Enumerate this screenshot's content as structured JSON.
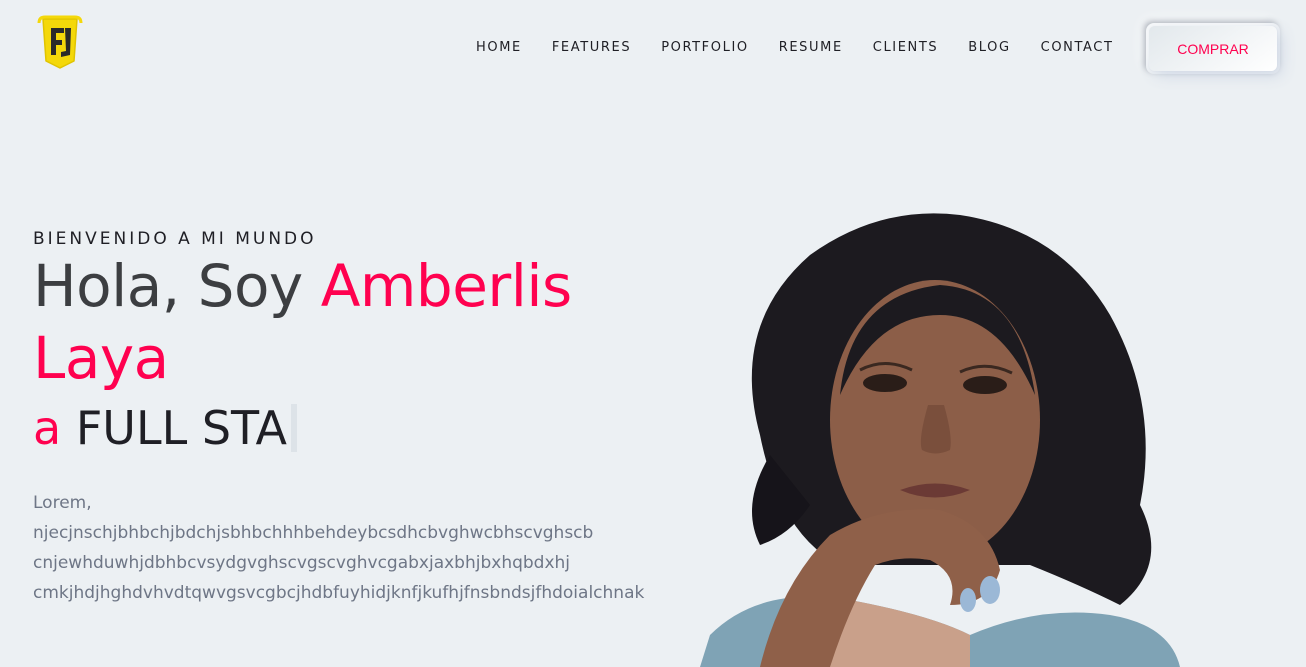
{
  "header": {
    "logo_icon": "js-shield-logo-icon",
    "nav": [
      {
        "label": "HOME"
      },
      {
        "label": "FEATURES"
      },
      {
        "label": "PORTFOLIO"
      },
      {
        "label": "RESUME"
      },
      {
        "label": "CLIENTS"
      },
      {
        "label": "BLOG"
      },
      {
        "label": "CONTACT"
      }
    ],
    "buy_label": "COMPRAR"
  },
  "hero": {
    "subtitle": "BIENVENIDO A MI MUNDO",
    "greeting": "Hola, Soy ",
    "name": "Amberlis Laya",
    "typed_prefix": "a ",
    "typed_text": "FULL STA",
    "description_lines": [
      "Lorem,",
      "njecjnschjbhbchjbdchjsbhbchhhbehdeybcsdhcbvghwcbhscvghscb",
      "cnjewhduwhjdbhbcvsydgvghscvgscvghvcgabxjaxbhjbxhqbdxhj",
      "cmkjhdjhghdvhvdtqwvgsvcgbcjhdbfuyhidjknfjkufhjfnsbndsjfhdoialchnak"
    ]
  },
  "colors": {
    "background": "#ecf0f3",
    "accent": "#ff014f",
    "heading": "#3c3e41",
    "body_text": "#6e7686"
  }
}
